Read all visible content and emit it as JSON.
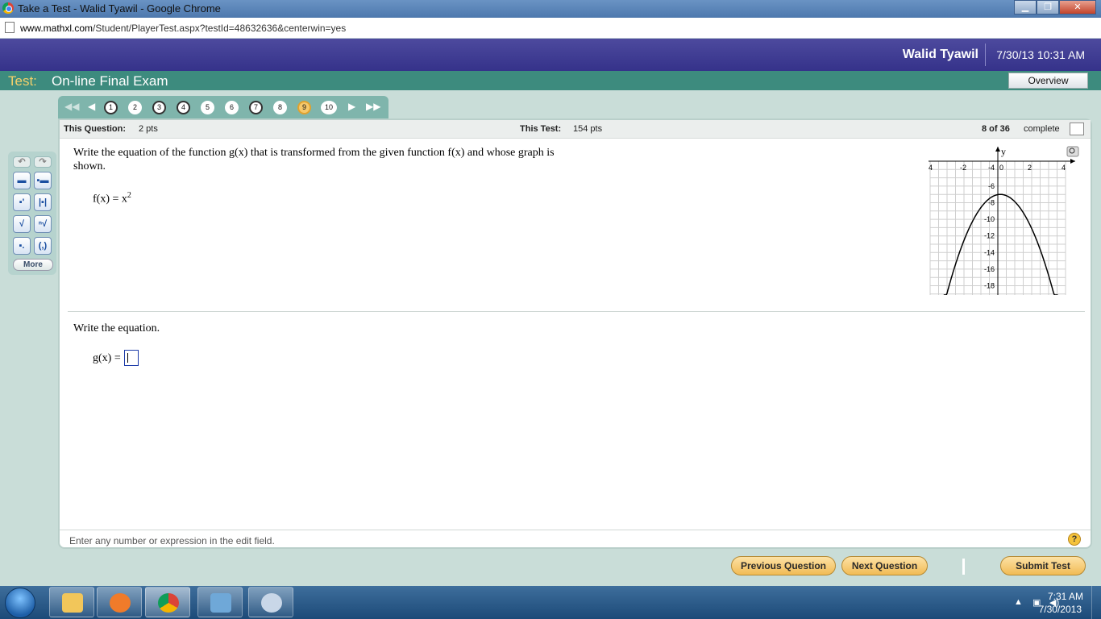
{
  "browser": {
    "title": "Take a Test - Walid Tyawil - Google Chrome",
    "url_host": "www.mathxl.com",
    "url_path": "/Student/PlayerTest.aspx?testId=48632636&centerwin=yes"
  },
  "header": {
    "user": "Walid Tyawil",
    "datetime": "7/30/13 10:31 AM"
  },
  "testbar": {
    "label": "Test:",
    "name": "On-line Final Exam",
    "overview_label": "Overview"
  },
  "question_nav": {
    "numbers": [
      "1",
      "2",
      "3",
      "4",
      "5",
      "6",
      "7",
      "8",
      "9",
      "10"
    ],
    "current": "9"
  },
  "info": {
    "this_question_label": "This Question:",
    "this_question_value": "2 pts",
    "this_test_label": "This Test:",
    "this_test_value": "154 pts",
    "progress": "8 of 36",
    "progress_label": "complete"
  },
  "question": {
    "prompt_line1": "Write the equation of the function g(x) that is transformed from the given function f(x) and whose graph is",
    "prompt_line2": "shown.",
    "given_function": "f(x) = x",
    "given_exponent": "2",
    "answer_prompt": "Write the equation.",
    "answer_label": "g(x) ="
  },
  "graph": {
    "axis_y_label": "y",
    "x_ticks": [
      "-4",
      "-2",
      "0",
      "2",
      "4"
    ],
    "y_ticks": [
      "-4",
      "-6",
      "-8",
      "-10",
      "-12",
      "-14",
      "-16",
      "-18"
    ]
  },
  "chart_data": {
    "type": "line",
    "title": "",
    "xlabel": "",
    "ylabel": "y",
    "xlim": [
      -4,
      4
    ],
    "ylim": [
      -19,
      -3
    ],
    "grid": true,
    "series": [
      {
        "x": [
          -3.5,
          -3,
          -2.5,
          -2,
          -1.5,
          -1,
          -0.5,
          0,
          0.5,
          1,
          1.5,
          2,
          2.5,
          3,
          3.5
        ],
        "y": [
          -19.2,
          -16.2,
          -13.7,
          -11.7,
          -10.2,
          -9.2,
          -8.7,
          -7.2,
          -7.5,
          -8,
          -9,
          -10.7,
          -12.8,
          -15.5,
          -18.9
        ]
      }
    ]
  },
  "palette": {
    "more_label": "More"
  },
  "hint": "Enter any number or expression in the edit field.",
  "buttons": {
    "previous": "Previous Question",
    "next": "Next Question",
    "submit": "Submit Test"
  },
  "taskbar": {
    "time": "7:31 AM",
    "date": "7/30/2013"
  }
}
